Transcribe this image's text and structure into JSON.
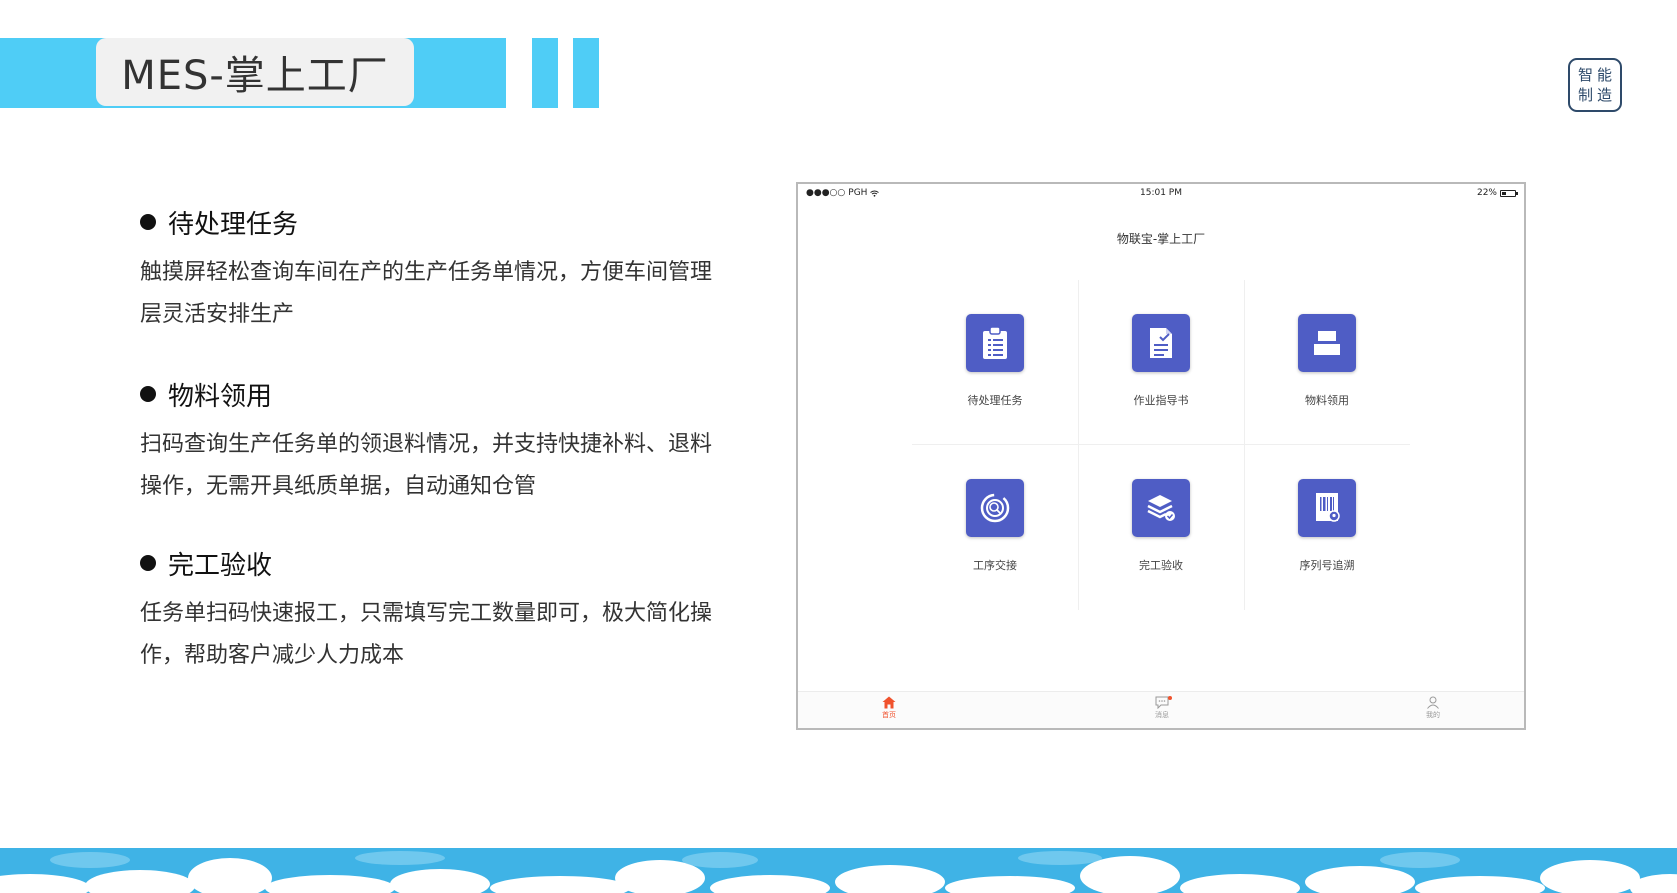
{
  "header": {
    "title": "MES-掌上工厂",
    "stamp_chars": [
      "智",
      "能",
      "制",
      "造"
    ]
  },
  "features": [
    {
      "title": "待处理任务",
      "desc": "触摸屏轻松查询车间在产的生产任务单情况，方便车间管理层灵活安排生产"
    },
    {
      "title": "物料领用",
      "desc": "扫码查询生产任务单的领退料情况，并支持快捷补料、退料操作，无需开具纸质单据，自动通知仓管"
    },
    {
      "title": "完工验收",
      "desc": "任务单扫码快速报工，只需填写完工数量即可，极大简化操作，帮助客户减少人力成本"
    }
  ],
  "device": {
    "status": {
      "carrier": "PGH",
      "time": "15:01 PM",
      "battery": "22%"
    },
    "app_title": "物联宝-掌上工厂",
    "tiles": [
      {
        "label": "待处理任务",
        "icon": "clipboard-list-icon"
      },
      {
        "label": "作业指导书",
        "icon": "document-check-icon"
      },
      {
        "label": "物料领用",
        "icon": "tray-box-icon"
      },
      {
        "label": "工序交接",
        "icon": "process-cycle-icon"
      },
      {
        "label": "完工验收",
        "icon": "stacked-layers-icon"
      },
      {
        "label": "序列号追溯",
        "icon": "barcode-location-icon"
      }
    ],
    "tabs": [
      {
        "label": "首页",
        "icon": "home-icon",
        "active": true
      },
      {
        "label": "消息",
        "icon": "message-icon",
        "active": false
      },
      {
        "label": "我的",
        "icon": "user-icon",
        "active": false
      }
    ]
  },
  "colors": {
    "banner": "#4fcdf6",
    "tile": "#4f5dc5",
    "active_tab": "#f0522d",
    "footer": "#3fb3e6"
  }
}
